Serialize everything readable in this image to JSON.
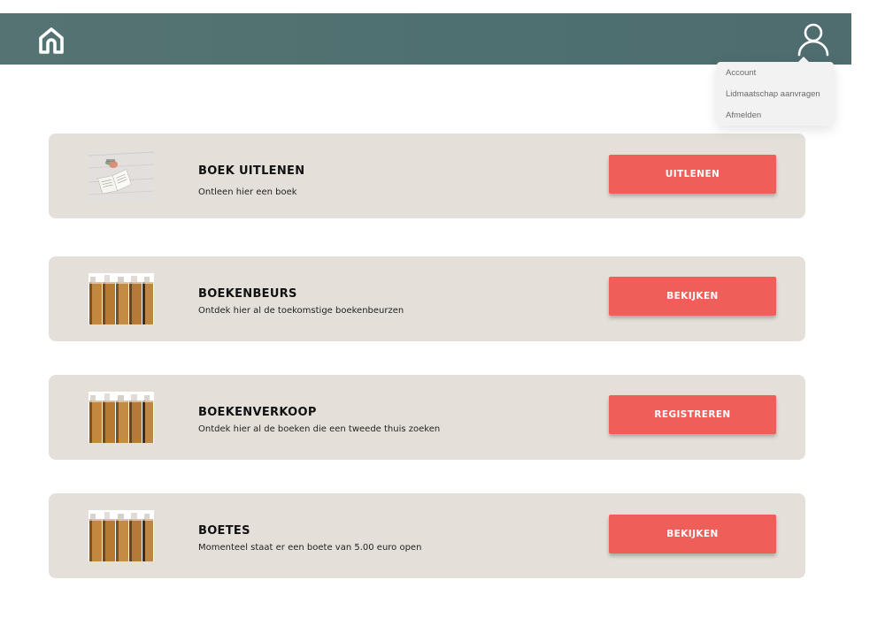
{
  "header": {
    "home_icon": "home-icon",
    "user_icon": "user-icon",
    "color": "#537273"
  },
  "user_menu": {
    "items": [
      {
        "label": "Account"
      },
      {
        "label": "Lidmaatschap aanvragen"
      },
      {
        "label": "Afmelden"
      }
    ]
  },
  "cards": [
    {
      "title": "BOEK UITLENEN",
      "description": "Ontleen hier een boek",
      "button": "UITLENEN",
      "image": "open-book-photo"
    },
    {
      "title": "BOEKENBEURS",
      "description": "Ontdek hier al de toekomstige boekenbeurzen",
      "button": "BEKIJKEN",
      "image": "book-spines-photo"
    },
    {
      "title": "BOEKENVERKOOP",
      "description": "Ontdek hier al de boeken die een tweede thuis zoeken",
      "button": "REGISTREREN",
      "image": "book-spines-photo"
    },
    {
      "title": "BOETES",
      "description": "Momenteel staat er een boete van 5.00 euro open",
      "button": "BEKIJKEN",
      "image": "book-spines-photo"
    }
  ],
  "colors": {
    "card_background": "#e4e0d9",
    "button": "#ef5e58",
    "header": "#537273"
  }
}
